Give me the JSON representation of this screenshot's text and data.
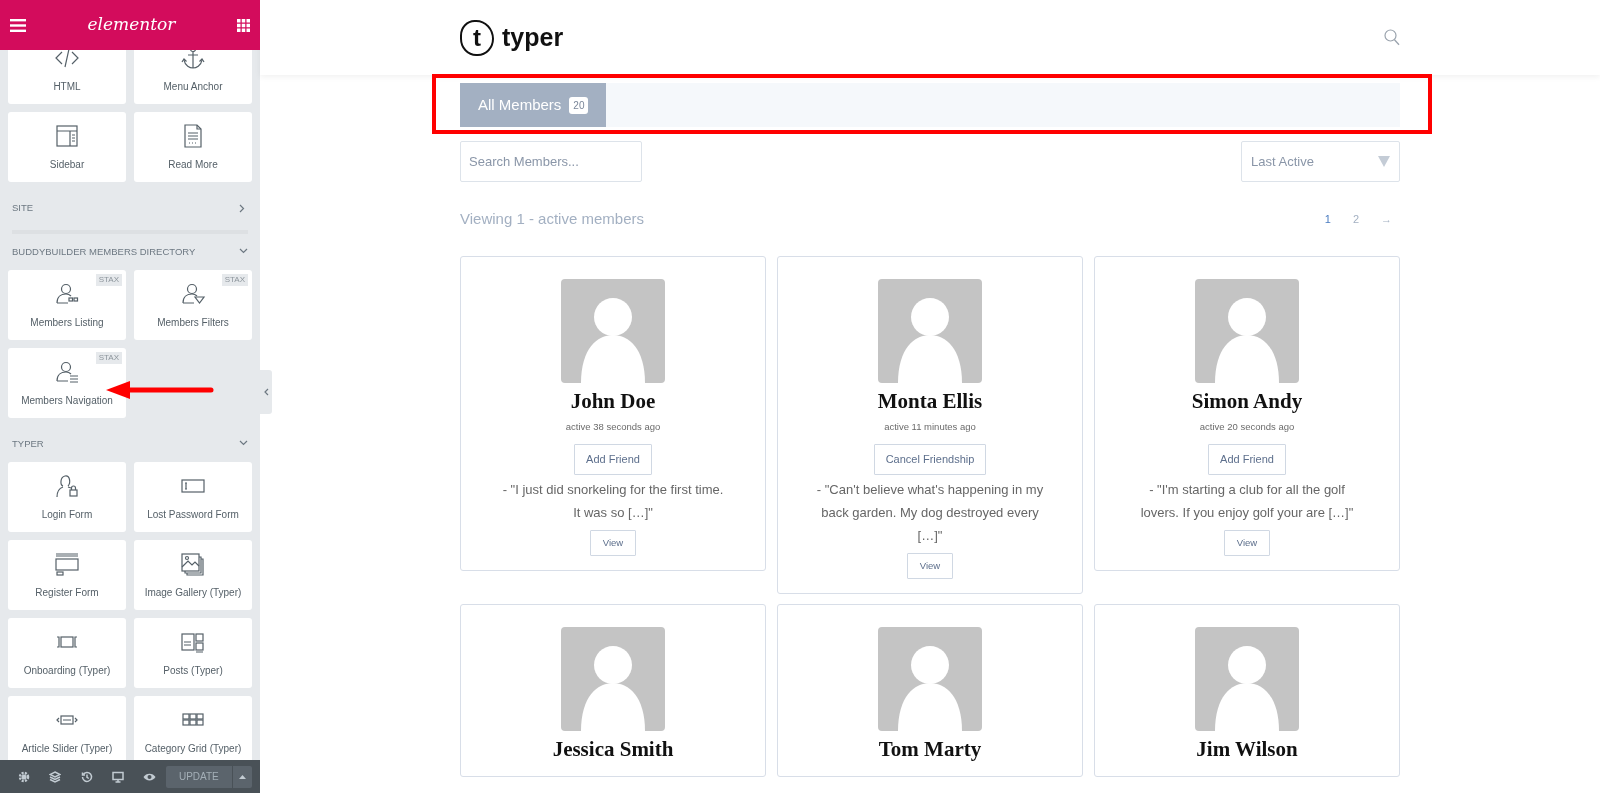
{
  "editor_panel": {
    "title": "elementor",
    "top_widgets": [
      {
        "label": "HTML"
      },
      {
        "label": "Menu Anchor"
      },
      {
        "label": "Sidebar"
      },
      {
        "label": "Read More"
      }
    ],
    "sections": [
      {
        "title": "SITE",
        "expanded": false
      },
      {
        "title": "BUDDYBUILDER MEMBERS DIRECTORY",
        "expanded": true,
        "widgets": [
          {
            "label": "Members Listing",
            "badge": "STAX"
          },
          {
            "label": "Members Filters",
            "badge": "STAX"
          },
          {
            "label": "Members Navigation",
            "badge": "STAX"
          }
        ]
      },
      {
        "title": "TYPER",
        "expanded": true,
        "widgets": [
          {
            "label": "Login Form"
          },
          {
            "label": "Lost Password Form"
          },
          {
            "label": "Register Form"
          },
          {
            "label": "Image Gallery (Typer)"
          },
          {
            "label": "Onboarding (Typer)"
          },
          {
            "label": "Posts (Typer)"
          },
          {
            "label": "Article Slider (Typer)"
          },
          {
            "label": "Category Grid (Typer)"
          }
        ]
      }
    ],
    "update_button": {
      "label": "UPDATE",
      "disabled": true
    }
  },
  "site": {
    "logo": {
      "mark": "t",
      "name": "typer"
    },
    "tabs": [
      {
        "label": "All Members",
        "count": "20",
        "selected": true
      }
    ],
    "search": {
      "placeholder": "Search Members..."
    },
    "sort": {
      "value": "Last Active"
    },
    "viewing": "Viewing 1 - active members",
    "pagination": [
      {
        "label": "1",
        "selected": true
      },
      {
        "label": "2",
        "selected": false
      },
      {
        "label": "→",
        "selected": false
      }
    ],
    "members": [
      {
        "name": "John Doe",
        "activity": "active 38 seconds ago",
        "action": "Add Friend",
        "excerpt": "- \"I just did snorkeling for the first time. It was so […]\"",
        "view": "View"
      },
      {
        "name": "Monta Ellis",
        "activity": "active 11 minutes ago",
        "action": "Cancel Friendship",
        "excerpt": "- \"Can't believe what's happening in my back garden. My dog destroyed every […]\"",
        "view": "View"
      },
      {
        "name": "Simon Andy",
        "activity": "active 20 seconds ago",
        "action": "Add Friend",
        "excerpt": "- \"I'm starting a club for all the golf lovers. If you enjoy golf your are […]\"",
        "view": "View"
      },
      {
        "name": "Jessica Smith"
      },
      {
        "name": "Tom Marty"
      },
      {
        "name": "Jim Wilson"
      }
    ]
  }
}
